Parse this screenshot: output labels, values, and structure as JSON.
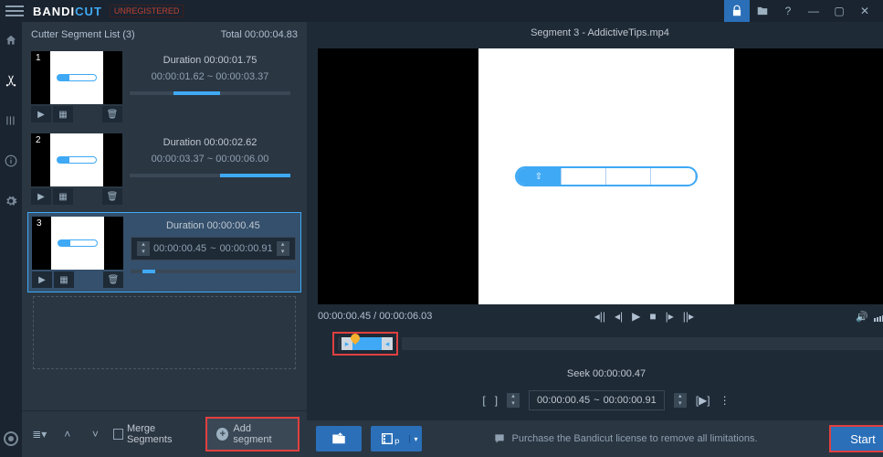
{
  "titlebar": {
    "logo1": "BANDI",
    "logo2": "CUT",
    "unreg": "UNREGISTERED"
  },
  "panel": {
    "title": "Cutter Segment List (3)",
    "total_label": "Total 00:00:04.83"
  },
  "segments": [
    {
      "num": "1",
      "duration": "Duration 00:00:01.75",
      "range": "00:00:01.62 ~ 00:00:03.37"
    },
    {
      "num": "2",
      "duration": "Duration 00:00:02.62",
      "range": "00:00:03.37 ~ 00:00:06.00"
    },
    {
      "num": "3",
      "duration": "Duration 00:00:00.45",
      "range_start": "00:00:00.45",
      "range_sep": "~",
      "range_end": "00:00:00.91"
    }
  ],
  "left_bottom": {
    "merge": "Merge Segments",
    "add": "Add segment"
  },
  "preview": {
    "title": "Segment 3 - AddictiveTips.mp4"
  },
  "time": {
    "current": "00:00:00.45 / 00:00:06.03"
  },
  "seek": {
    "label": "Seek 00:00:00.47",
    "start": "00:00:00.45",
    "sep": "~",
    "end": "00:00:00.91"
  },
  "license": "Purchase the Bandicut license to remove all limitations.",
  "start": "Start"
}
